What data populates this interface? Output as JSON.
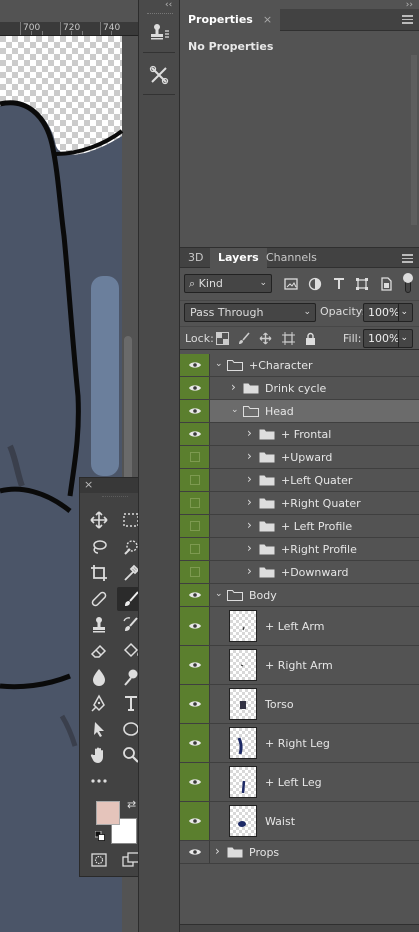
{
  "ruler": {
    "marks": [
      "700",
      "720",
      "740"
    ]
  },
  "colors": {
    "canvas_bg": "#4b5568",
    "visibility_bg": "#5b7f2e",
    "foreground_color": "#e5c4bb",
    "background_color": "#ffffff"
  },
  "tools_panel": {
    "tools": [
      {
        "name": "move-tool",
        "icon": "move-icon"
      },
      {
        "name": "marquee-tool",
        "icon": "marquee-icon"
      },
      {
        "name": "lasso-tool",
        "icon": "lasso-icon"
      },
      {
        "name": "quick-select-tool",
        "icon": "quick-select-icon"
      },
      {
        "name": "crop-tool",
        "icon": "crop-icon"
      },
      {
        "name": "eyedropper-tool",
        "icon": "eyedropper-icon"
      },
      {
        "name": "healing-brush-tool",
        "icon": "bandage-icon"
      },
      {
        "name": "brush-tool",
        "icon": "brush-icon",
        "active": true
      },
      {
        "name": "clone-stamp-tool",
        "icon": "stamp-icon"
      },
      {
        "name": "history-brush-tool",
        "icon": "history-brush-icon"
      },
      {
        "name": "eraser-tool",
        "icon": "eraser-icon"
      },
      {
        "name": "paint-bucket-tool",
        "icon": "paint-bucket-icon"
      },
      {
        "name": "blur-tool",
        "icon": "blur-icon"
      },
      {
        "name": "dodge-tool",
        "icon": "dodge-icon"
      },
      {
        "name": "pen-tool",
        "icon": "pen-icon"
      },
      {
        "name": "type-tool",
        "icon": "type-icon"
      },
      {
        "name": "path-select-tool",
        "icon": "arrow-icon"
      },
      {
        "name": "ellipse-tool",
        "icon": "ellipse-icon"
      },
      {
        "name": "hand-tool",
        "icon": "hand-icon"
      },
      {
        "name": "zoom-tool",
        "icon": "zoom-icon"
      },
      {
        "name": "more-tools",
        "icon": "ellipsis-icon"
      }
    ]
  },
  "properties": {
    "tab": "Properties",
    "close": "×",
    "body_text": "No Properties"
  },
  "layers_panel": {
    "tabs": [
      "3D",
      "Layers",
      "Channels"
    ],
    "active_tab": "Layers",
    "filter_kind": "Kind",
    "blend_mode": "Pass Through",
    "opacity_label": "Opacity:",
    "opacity_value": "100%",
    "lock_label": "Lock:",
    "fill_label": "Fill:",
    "fill_value": "100%",
    "layers": [
      {
        "name": "+Character",
        "type": "group",
        "level": 0,
        "expanded": true,
        "visible": true
      },
      {
        "name": "Drink cycle",
        "type": "group",
        "level": 1,
        "expanded": false,
        "visible": true
      },
      {
        "name": "Head",
        "type": "group",
        "level": 1,
        "expanded": true,
        "visible": true,
        "selected": true
      },
      {
        "name": "+ Frontal",
        "type": "group",
        "level": 2,
        "expanded": false,
        "visible": true
      },
      {
        "name": "+Upward",
        "type": "group",
        "level": 2,
        "expanded": false,
        "visible": false
      },
      {
        "name": "+Left Quater",
        "type": "group",
        "level": 2,
        "expanded": false,
        "visible": false
      },
      {
        "name": "+Right Quater",
        "type": "group",
        "level": 2,
        "expanded": false,
        "visible": false
      },
      {
        "name": "+ Left Profile",
        "type": "group",
        "level": 2,
        "expanded": false,
        "visible": false
      },
      {
        "name": "+Right  Profile",
        "type": "group",
        "level": 2,
        "expanded": false,
        "visible": false
      },
      {
        "name": "+Downward",
        "type": "group",
        "level": 2,
        "expanded": false,
        "visible": false
      },
      {
        "name": "Body",
        "type": "group",
        "level": 0,
        "expanded": true,
        "visible": true
      },
      {
        "name": "+ Left Arm",
        "type": "layer",
        "visible": true,
        "thumb": "left-arm-thumbnail"
      },
      {
        "name": "+ Right Arm",
        "type": "layer",
        "visible": true,
        "thumb": "right-arm-thumbnail"
      },
      {
        "name": "Torso",
        "type": "layer",
        "visible": true,
        "thumb": "torso-thumbnail"
      },
      {
        "name": "+ Right Leg",
        "type": "layer",
        "visible": true,
        "thumb": "right-leg-thumbnail"
      },
      {
        "name": "+ Left Leg",
        "type": "layer",
        "visible": true,
        "thumb": "left-leg-thumbnail"
      },
      {
        "name": "Waist",
        "type": "layer",
        "visible": true,
        "thumb": "waist-thumbnail"
      },
      {
        "name": "Props",
        "type": "group",
        "level": 0,
        "expanded": false,
        "visible": true,
        "plain": true
      }
    ]
  }
}
